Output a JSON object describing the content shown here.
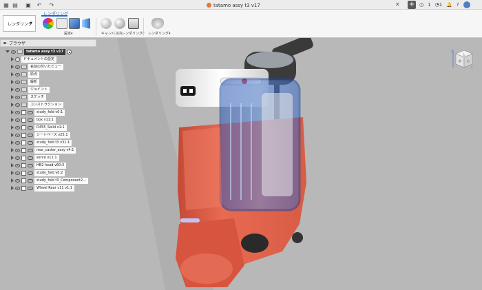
{
  "titlebar": {
    "doc_title": "tatamo assy t3 v17",
    "close_glyph": "✕",
    "plus_glyph": "+",
    "counter_a": "1",
    "counter_b": "1",
    "icons": [
      "grid-icon",
      "file-icon",
      "save-icon",
      "undo-icon",
      "redo-icon",
      "clock-icon",
      "bell-icon",
      "help-icon",
      "avatar"
    ]
  },
  "ribbon": {
    "workspace_label": "レンダリング",
    "active_tab": "レンダリング",
    "group_setup": "設定",
    "group_canvas": "キャンバス内レンダリング",
    "group_render": "レンダリング",
    "accent": "#1b6ac9"
  },
  "browser": {
    "title": "ブラウザ",
    "root_label": "tatamo assy t3 v17",
    "items": [
      {
        "label": "ドキュメントの設定",
        "icon": "gear"
      },
      {
        "label": "名前の付いたビュー",
        "icon": "folder"
      },
      {
        "label": "原点",
        "icon": "folder"
      },
      {
        "label": "解析",
        "icon": "folder"
      },
      {
        "label": "ジョイント",
        "icon": "folder"
      },
      {
        "label": "スケッチ",
        "icon": "folder"
      },
      {
        "label": "コンストラクション",
        "icon": "folder"
      },
      {
        "label": "study_fold v0:1",
        "icon": "component"
      },
      {
        "label": "box v11:1",
        "icon": "component"
      },
      {
        "label": "D455_Solid v1:1",
        "icon": "component"
      },
      {
        "label": "シートベース v25:1",
        "icon": "component"
      },
      {
        "label": "study_fold   t3 v31:1",
        "icon": "component"
      },
      {
        "label": "rear_caster_assy v4:1",
        "icon": "component"
      },
      {
        "label": "servo v11:1",
        "icon": "component"
      },
      {
        "label": "HB2 head v60:3",
        "icon": "component"
      },
      {
        "label": "study_fold v0:2",
        "icon": "component"
      },
      {
        "label": "study_fold   t3_Component2...",
        "icon": "component"
      },
      {
        "label": "Wheel Rear v11 v1:1",
        "icon": "component"
      }
    ]
  },
  "viewcube": {
    "top": "上",
    "front": "前",
    "right": "右",
    "axis_z": "Z",
    "axis_y": "Y"
  },
  "colors": {
    "body": "#e0654e",
    "blue_panel": "#3d6fc9",
    "background": "#b8b8b8"
  }
}
